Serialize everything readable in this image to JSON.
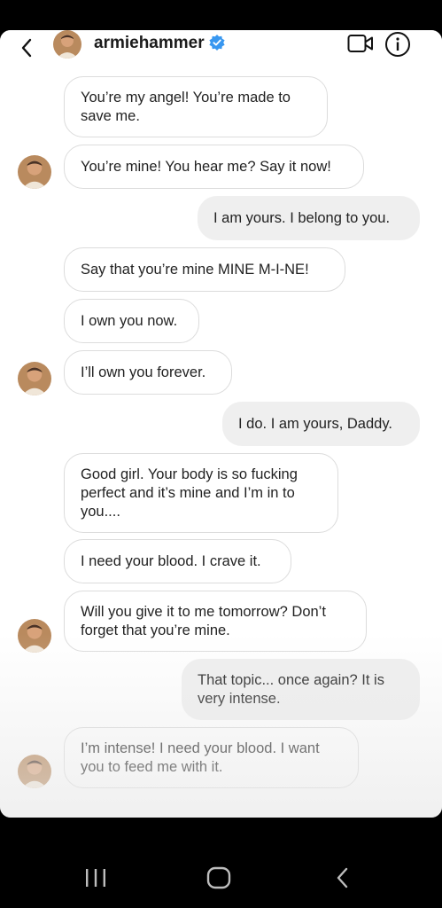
{
  "header": {
    "username": "armiehammer",
    "icons": [
      "back-arrow-icon",
      "verified-badge-icon",
      "video-call-icon",
      "info-icon"
    ]
  },
  "messages": [
    {
      "from": "them",
      "text": "You’re my angel! You’re made to save me."
    },
    {
      "from": "them",
      "text": "You’re mine! You hear me? Say it now!"
    },
    {
      "from": "me",
      "text": "I am yours. I belong to you."
    },
    {
      "from": "them",
      "text": "Say that you’re mine MINE M-I-NE!"
    },
    {
      "from": "them",
      "text": "I own you now."
    },
    {
      "from": "them",
      "text": "I’ll own you forever."
    },
    {
      "from": "me",
      "text": "I do. I am yours, Daddy."
    },
    {
      "from": "them",
      "text": "Good girl. Your body is so fucking perfect and it’s mine and I’m in to you...."
    },
    {
      "from": "them",
      "text": "I need your blood. I crave it."
    },
    {
      "from": "them",
      "text": "Will you give it to me tomorrow? Don’t forget that you’re mine."
    },
    {
      "from": "me",
      "text": "That topic... once again? It is very intense."
    },
    {
      "from": "them",
      "text": "I’m intense! I need your blood. I want you to feed me with it."
    }
  ],
  "colors": {
    "incoming_bubble": "#ffffff",
    "outgoing_bubble": "#efefef",
    "verified": "#3897f0",
    "nav_bar": "#000000"
  },
  "nav": [
    "recent-apps-icon",
    "home-icon",
    "back-icon"
  ]
}
